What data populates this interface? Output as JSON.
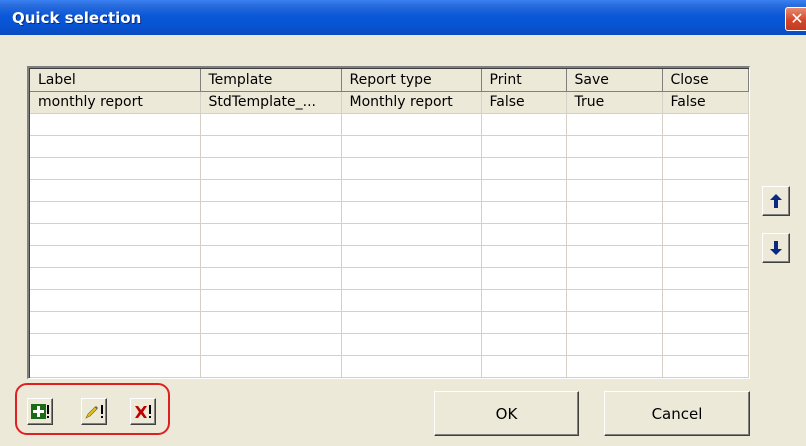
{
  "window": {
    "title": "Quick selection",
    "close_glyph": "✕"
  },
  "grid": {
    "columns": [
      "Label",
      "Template",
      "Report type",
      "Print",
      "Save",
      "Close"
    ],
    "rows": [
      [
        "monthly report",
        "StdTemplate_...",
        "Monthly report",
        "False",
        "True",
        "False"
      ]
    ]
  },
  "side_buttons": {
    "up_icon": "arrow-up-icon",
    "down_icon": "arrow-down-icon"
  },
  "toolbar": {
    "add_icon": "add-icon",
    "edit_icon": "edit-icon",
    "delete_icon": "delete-icon"
  },
  "buttons": {
    "ok_label": "OK",
    "cancel_label": "Cancel"
  },
  "colors": {
    "titlebar_blue": "#0a57d8",
    "dialog_bg": "#ece9d8",
    "highlight_red": "#e02020"
  }
}
